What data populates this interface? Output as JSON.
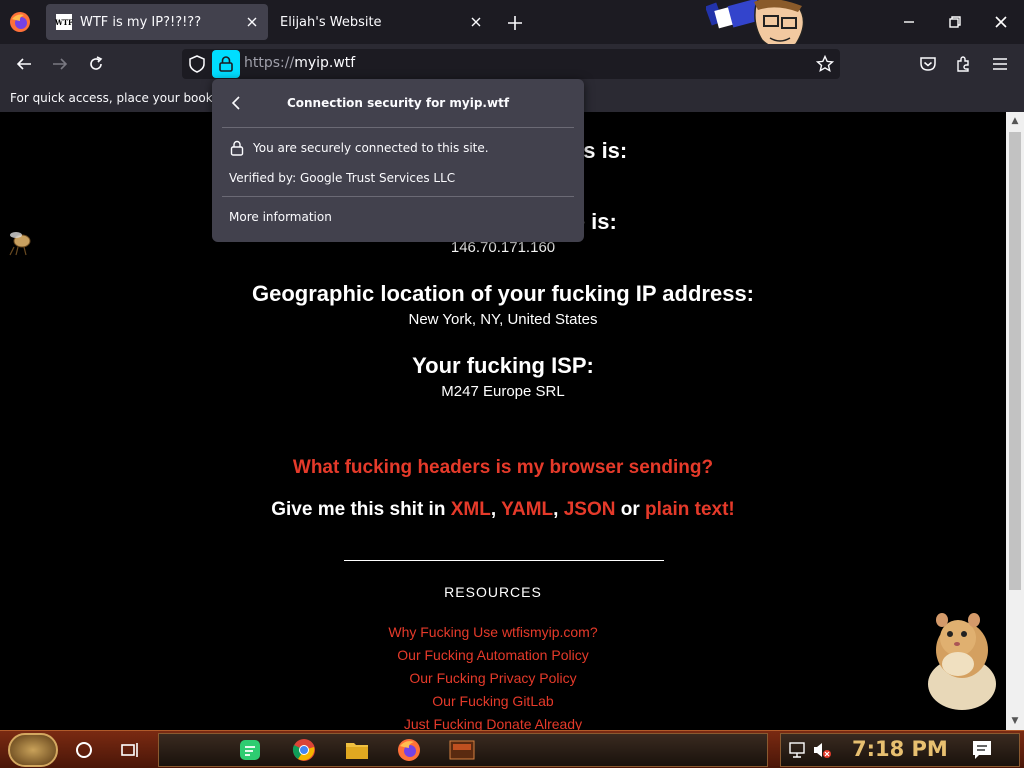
{
  "tabs": [
    {
      "favicon": "WTF",
      "title": "WTF is my IP?!?!??",
      "active": true
    },
    {
      "title": "Elijah's Website",
      "active": false
    }
  ],
  "url": {
    "scheme": "https://",
    "host": "myip.wtf"
  },
  "bookmarks_bar": {
    "text": "For quick access, place your bookmar"
  },
  "popup": {
    "title": "Connection security for myip.wtf",
    "secure": "You are securely connected to this site.",
    "verified": "Verified by: Google Trust Services LLC",
    "more": "More information"
  },
  "page": {
    "partial_heading_1": "ess is:",
    "partial_heading_2": "me is:",
    "hostname_value": "146.70.171.160",
    "geo_heading": "Geographic location of your fucking IP address:",
    "geo_value": "New York, NY, United States",
    "isp_heading": "Your fucking ISP:",
    "isp_value": "M247 Europe SRL",
    "headers_link": "What fucking headers is my browser sending?",
    "giveme_prefix": "Give me this shit in",
    "fmt_xml": "XML",
    "fmt_yaml": "YAML",
    "fmt_json": "JSON",
    "fmt_or": "or",
    "fmt_plain": "plain text!",
    "resources_title": "RESOURCES",
    "resources": [
      "Why Fucking Use wtfismyip.com?",
      "Our Fucking Automation Policy",
      "Our Fucking Privacy Policy",
      "Our Fucking GitLab",
      "Just Fucking Donate Already"
    ]
  },
  "taskbar": {
    "clock": "7:18 PM"
  },
  "colors": {
    "accent_link": "#e53a2a",
    "lock_highlight": "#00ddff"
  }
}
